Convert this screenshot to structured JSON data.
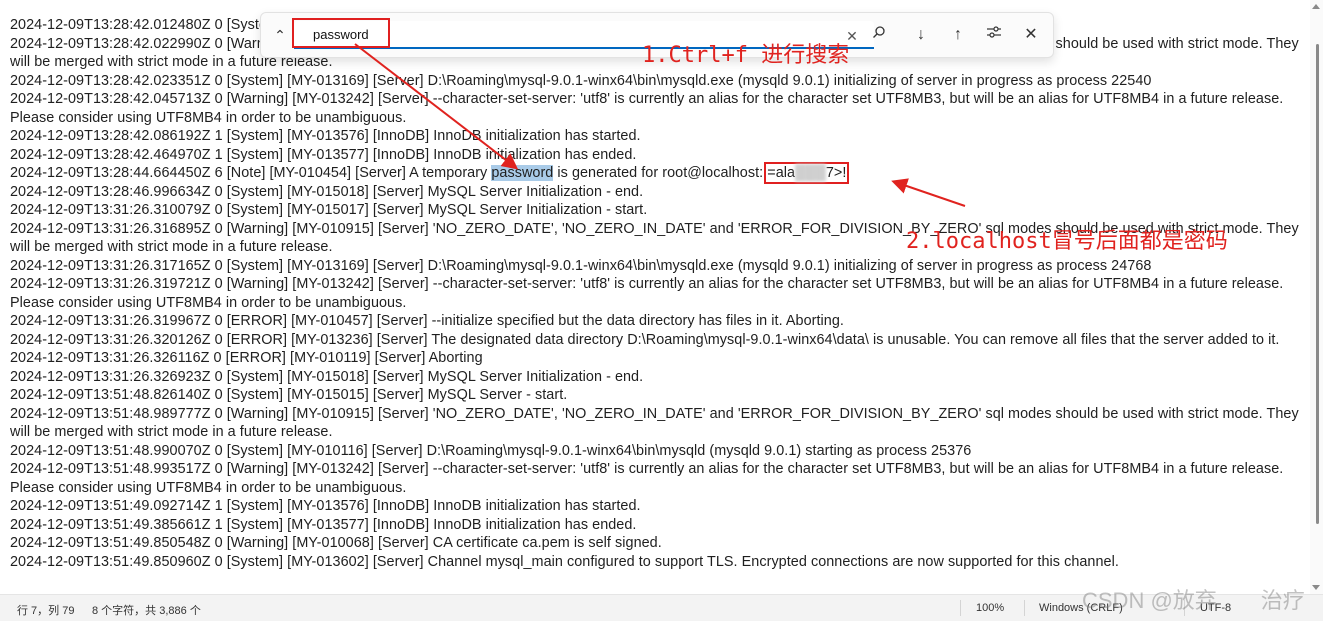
{
  "find_bar": {
    "query": "password",
    "toggle_icon": "chevron-up-icon",
    "clear_icon": "close-icon",
    "search_icon": "search-icon",
    "next_icon": "arrow-down-icon",
    "prev_icon": "arrow-up-icon",
    "options_icon": "sliders-icon",
    "close_icon": "close-icon"
  },
  "log_lines": [
    "2024-12-09T13:28:42.012480Z 0 [System]",
    "2024-12-09T13:28:42.022990Z 0 [Warning] [MY-010915] [Server] 'NO_ZERO_DATE', 'NO_ZERO_IN_DATE' and 'ERROR_FOR_DIVISION_BY_ZERO' sql modes should be used with strict mode. They will be merged with strict mode in a future release.",
    "2024-12-09T13:28:42.023351Z 0 [System] [MY-013169] [Server] D:\\Roaming\\mysql-9.0.1-winx64\\bin\\mysqld.exe (mysqld 9.0.1) initializing of server in progress as process 22540",
    "2024-12-09T13:28:42.045713Z 0 [Warning] [MY-013242] [Server] --character-set-server: 'utf8' is currently an alias for the character set UTF8MB3, but will be an alias for UTF8MB4 in a future release. Please consider using UTF8MB4 in order to be unambiguous.",
    "2024-12-09T13:28:42.086192Z 1 [System] [MY-013576] [InnoDB] InnoDB initialization has started.",
    "2024-12-09T13:28:42.464970Z 1 [System] [MY-013577] [InnoDB] InnoDB initialization has ended.",
    "2024-12-09T13:28:46.996634Z 0 [System] [MY-015018] [Server] MySQL Server Initialization - end.",
    "2024-12-09T13:31:26.310079Z 0 [System] [MY-015017] [Server] MySQL Server Initialization - start.",
    "2024-12-09T13:31:26.316895Z 0 [Warning] [MY-010915] [Server] 'NO_ZERO_DATE', 'NO_ZERO_IN_DATE' and 'ERROR_FOR_DIVISION_BY_ZERO' sql modes should be used with strict mode. They will be merged with strict mode in a future release.",
    "2024-12-09T13:31:26.317165Z 0 [System] [MY-013169] [Server] D:\\Roaming\\mysql-9.0.1-winx64\\bin\\mysqld.exe (mysqld 9.0.1) initializing of server in progress as process 24768",
    "2024-12-09T13:31:26.319721Z 0 [Warning] [MY-013242] [Server] --character-set-server: 'utf8' is currently an alias for the character set UTF8MB3, but will be an alias for UTF8MB4 in a future release. Please consider using UTF8MB4 in order to be unambiguous.",
    "2024-12-09T13:31:26.319967Z 0 [ERROR] [MY-010457] [Server] --initialize specified but the data directory has files in it. Aborting.",
    "2024-12-09T13:31:26.320126Z 0 [ERROR] [MY-013236] [Server] The designated data directory D:\\Roaming\\mysql-9.0.1-winx64\\data\\ is unusable. You can remove all files that the server added to it.",
    "2024-12-09T13:31:26.326116Z 0 [ERROR] [MY-010119] [Server] Aborting",
    "2024-12-09T13:31:26.326923Z 0 [System] [MY-015018] [Server] MySQL Server Initialization - end.",
    "2024-12-09T13:51:48.826140Z 0 [System] [MY-015015] [Server] MySQL Server - start.",
    "2024-12-09T13:51:48.989777Z 0 [Warning] [MY-010915] [Server] 'NO_ZERO_DATE', 'NO_ZERO_IN_DATE' and 'ERROR_FOR_DIVISION_BY_ZERO' sql modes should be used with strict mode. They will be merged with strict mode in a future release.",
    "2024-12-09T13:51:48.990070Z 0 [System] [MY-010116] [Server] D:\\Roaming\\mysql-9.0.1-winx64\\bin\\mysqld (mysqld 9.0.1) starting as process 25376",
    "2024-12-09T13:51:48.993517Z 0 [Warning] [MY-013242] [Server] --character-set-server: 'utf8' is currently an alias for the character set UTF8MB3, but will be an alias for UTF8MB4 in a future release. Please consider using UTF8MB4 in order to be unambiguous.",
    "2024-12-09T13:51:49.092714Z 1 [System] [MY-013576] [InnoDB] InnoDB initialization has started.",
    "2024-12-09T13:51:49.385661Z 1 [System] [MY-013577] [InnoDB] InnoDB initialization has ended.",
    "2024-12-09T13:51:49.850548Z 0 [Warning] [MY-010068] [Server] CA certificate ca.pem is self signed.",
    "2024-12-09T13:51:49.850960Z 0 [System] [MY-013602] [Server] Channel mysql_main configured to support TLS. Encrypted connections are now supported for this channel."
  ],
  "password_line": {
    "prefix": "2024-12-09T13:28:44.664450Z 6 [Note] [MY-010454] [Server] A temporary ",
    "match": "password",
    "middle": " is generated for root@localhost: ",
    "secret_start": "=ala",
    "secret_masked": "███",
    "secret_end": "7>!"
  },
  "annotations": {
    "step1": "1.Ctrl+f 进行搜索",
    "step2": "2.localhost冒号后面都是密码",
    "color": "#e0231f"
  },
  "status_bar": {
    "position": "行 7，列 79",
    "char_count": "8 个字符，共 3,886 个",
    "zoom": "100%",
    "line_ending": "Windows (CRLF)",
    "encoding": "UTF-8"
  },
  "watermark": "CSDN @放弃　　治疗",
  "colors": {
    "find_underline": "#0067c0",
    "match_highlight": "#a9cbe8"
  }
}
